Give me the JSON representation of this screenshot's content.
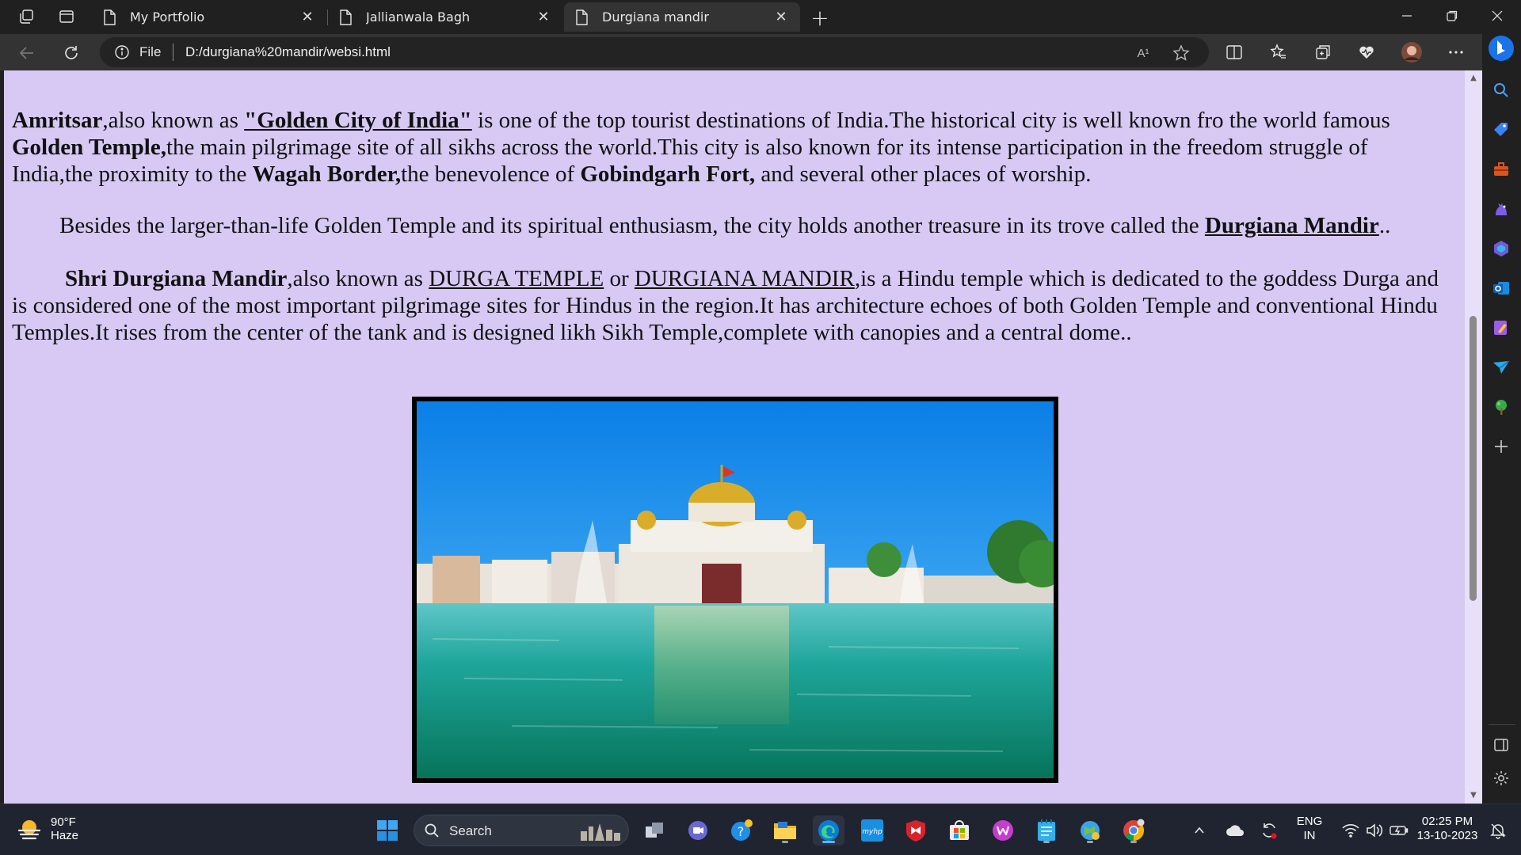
{
  "browser": {
    "tabs": [
      {
        "title": "My Portfolio",
        "active": false
      },
      {
        "title": "Jallianwala Bagh",
        "active": false
      },
      {
        "title": "Durgiana mandir",
        "active": true
      }
    ],
    "address": {
      "scheme_label": "File",
      "url": "D:/durgiana%20mandir/websi.html"
    },
    "read_aloud_label": "A¹"
  },
  "page": {
    "p1": {
      "s1": "Amritsar",
      "s2": ",also known as ",
      "s3": "\"Golden City of India\"",
      "s4": " is one of the top tourist destinations of India.The historical city is well known fro the world famous ",
      "s5": "Golden Temple,",
      "s6": "the main pilgrimage site of all sikhs across the world.This city is also known for its intense participation in the freedom struggle of India,the proximity to the ",
      "s7": "Wagah Border,",
      "s8": "the benevolence of ",
      "s9": "Gobindgarh Fort,",
      "s10": " and several other places of worship."
    },
    "p2": {
      "s1": "Besides the larger-than-life Golden Temple and its spiritual enthusiasm, the city holds another treasure in its trove called the ",
      "s2": "Durgiana Mandir",
      "s3": ".."
    },
    "p3": {
      "s1": "Shri Durgiana Mandir",
      "s2": ",also known as ",
      "s3": "DURGA TEMPLE",
      "s4": " or ",
      "s5": "DURGIANA MANDIR",
      "s6": ",is a Hindu temple which is dedicated to the goddess Durga and is considered one of the most important pilgrimage sites for Hindus in the region.It has architecture echoes of both Golden Temple and conventional Hindu Temples.It rises from the center of the tank and is designed likh Sikh Temple,complete with canopies and a central dome.."
    },
    "background_color": "#d7c9f3"
  },
  "taskbar": {
    "weather": {
      "temp": "90°F",
      "condition": "Haze"
    },
    "search_label": "Search",
    "language": {
      "lang": "ENG",
      "region": "IN"
    },
    "clock": {
      "time": "02:25 PM",
      "date": "13-10-2023"
    },
    "apps": [
      "start-icon",
      "task-view-icon",
      "teams-chat-icon",
      "help-icon",
      "file-explorer-icon",
      "edge-icon",
      "myhp-icon",
      "mcafee-icon",
      "store-icon",
      "wps-icon",
      "notepad-icon",
      "maps-icon",
      "chrome-icon"
    ]
  }
}
